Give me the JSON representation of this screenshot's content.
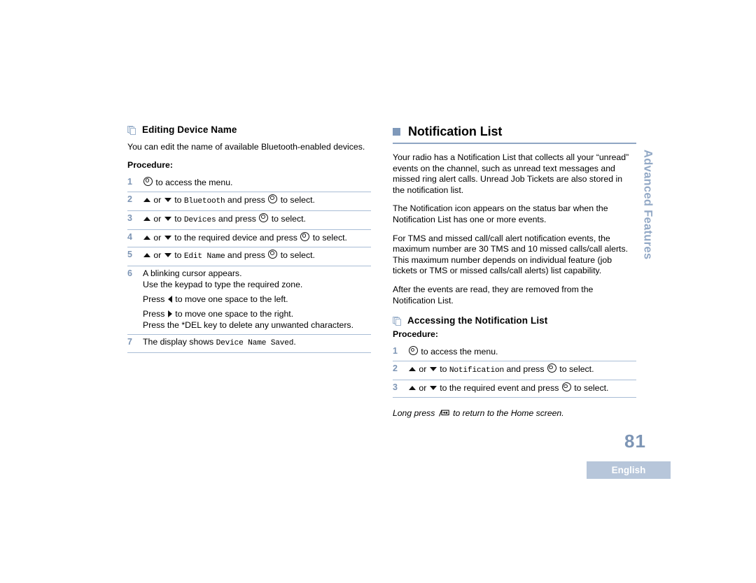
{
  "document": {
    "page_number": "81",
    "language_tab": "English",
    "side_tab": "Advanced Features",
    "colors": {
      "accent_blue": "#7d95b5",
      "rule_blue": "#8fa6c4",
      "bullet_blue": "#7f99ba",
      "lang_box": "#b7c6da",
      "side_tab_text": "#93a9c6"
    }
  },
  "left_column": {
    "heading": "Editing Device Name",
    "heading_icon": "stacked-pages-icon",
    "intro": "You can edit the name of available Bluetooth-enabled devices.",
    "procedure_label": "Procedure:",
    "steps": [
      {
        "num": "1",
        "parts": [
          {
            "type": "icon",
            "icon": "menu-button-icon"
          },
          {
            "type": "text",
            "text": " to access the menu."
          }
        ]
      },
      {
        "num": "2",
        "parts": [
          {
            "type": "icon",
            "icon": "arrow-up-icon"
          },
          {
            "type": "text",
            "text": " or "
          },
          {
            "type": "icon",
            "icon": "arrow-down-icon"
          },
          {
            "type": "text",
            "text": " to "
          },
          {
            "type": "mono",
            "text": "Bluetooth"
          },
          {
            "type": "text",
            "text": " and press "
          },
          {
            "type": "icon",
            "icon": "menu-button-icon"
          },
          {
            "type": "text",
            "text": " to select."
          }
        ]
      },
      {
        "num": "3",
        "parts": [
          {
            "type": "icon",
            "icon": "arrow-up-icon"
          },
          {
            "type": "text",
            "text": " or "
          },
          {
            "type": "icon",
            "icon": "arrow-down-icon"
          },
          {
            "type": "text",
            "text": " to "
          },
          {
            "type": "mono",
            "text": "Devices"
          },
          {
            "type": "text",
            "text": " and press "
          },
          {
            "type": "icon",
            "icon": "menu-button-icon"
          },
          {
            "type": "text",
            "text": " to select."
          }
        ]
      },
      {
        "num": "4",
        "parts": [
          {
            "type": "icon",
            "icon": "arrow-up-icon"
          },
          {
            "type": "text",
            "text": " or "
          },
          {
            "type": "icon",
            "icon": "arrow-down-icon"
          },
          {
            "type": "text",
            "text": " to the required device and press "
          },
          {
            "type": "icon",
            "icon": "menu-button-icon"
          },
          {
            "type": "text",
            "text": " to select."
          }
        ]
      },
      {
        "num": "5",
        "parts": [
          {
            "type": "icon",
            "icon": "arrow-up-icon"
          },
          {
            "type": "text",
            "text": " or "
          },
          {
            "type": "icon",
            "icon": "arrow-down-icon"
          },
          {
            "type": "text",
            "text": " to "
          },
          {
            "type": "mono",
            "text": "Edit Name"
          },
          {
            "type": "text",
            "text": " and press "
          },
          {
            "type": "icon",
            "icon": "menu-button-icon"
          },
          {
            "type": "text",
            "text": " to select."
          }
        ]
      },
      {
        "num": "6",
        "lines": [
          {
            "parts": [
              {
                "type": "text",
                "text": "A blinking cursor appears."
              }
            ]
          },
          {
            "parts": [
              {
                "type": "text",
                "text": "Use the keypad to type the required zone."
              }
            ]
          },
          {
            "spaced": true,
            "parts": [
              {
                "type": "text",
                "text": "Press "
              },
              {
                "type": "icon",
                "icon": "arrow-left-icon"
              },
              {
                "type": "text",
                "text": " to move one space to the left."
              }
            ]
          },
          {
            "spaced": true,
            "parts": [
              {
                "type": "text",
                "text": "Press "
              },
              {
                "type": "icon",
                "icon": "arrow-right-icon"
              },
              {
                "type": "text",
                "text": " to move one space to the right."
              }
            ]
          },
          {
            "parts": [
              {
                "type": "text",
                "text": "Press the *DEL key to delete any unwanted characters."
              }
            ]
          }
        ]
      },
      {
        "num": "7",
        "parts": [
          {
            "type": "text",
            "text": "The display shows "
          },
          {
            "type": "mono",
            "text": "Device Name Saved"
          },
          {
            "type": "text",
            "text": "."
          }
        ]
      }
    ]
  },
  "right_column": {
    "heading": "Notification List",
    "heading_icon": "square-bullet-icon",
    "paragraphs": [
      "Your radio has a Notification List that collects all your “unread” events on the channel, such as unread text messages and missed ring alert calls. Unread Job Tickets are also stored in the notification list.",
      "The Notification icon appears on the status bar when the Notification List has one or more events.",
      "For TMS and missed call/call alert notification events, the maximum number are 30 TMS and 10 missed calls/call alerts. This maximum number depends on individual feature (job tickets or TMS or missed calls/call alerts) list capability.",
      "After the events are read, they are removed from the Notification List."
    ],
    "subheading": "Accessing the Notification List",
    "subheading_icon": "stacked-pages-icon",
    "procedure_label": "Procedure:",
    "steps": [
      {
        "num": "1",
        "parts": [
          {
            "type": "icon",
            "icon": "menu-button-icon"
          },
          {
            "type": "text",
            "text": " to access the menu."
          }
        ]
      },
      {
        "num": "2",
        "parts": [
          {
            "type": "icon",
            "icon": "arrow-up-icon"
          },
          {
            "type": "text",
            "text": " or "
          },
          {
            "type": "icon",
            "icon": "arrow-down-icon"
          },
          {
            "type": "text",
            "text": " to "
          },
          {
            "type": "mono",
            "text": "Notification"
          },
          {
            "type": "text",
            "text": " and press "
          },
          {
            "type": "icon",
            "icon": "menu-button-icon"
          },
          {
            "type": "text",
            "text": " to select."
          }
        ]
      },
      {
        "num": "3",
        "parts": [
          {
            "type": "icon",
            "icon": "arrow-up-icon"
          },
          {
            "type": "text",
            "text": " or "
          },
          {
            "type": "icon",
            "icon": "arrow-down-icon"
          },
          {
            "type": "text",
            "text": " to the required event and press "
          },
          {
            "type": "icon",
            "icon": "menu-button-icon"
          },
          {
            "type": "text",
            "text": " to select."
          }
        ]
      }
    ],
    "note": {
      "before": "Long press ",
      "icon": "home-button-icon",
      "after": " to return to the Home screen."
    }
  }
}
